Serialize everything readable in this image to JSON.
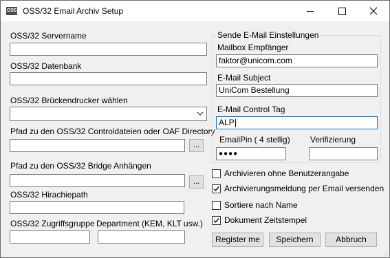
{
  "window": {
    "title": "OSS/32 Email Archiv Setup",
    "icon_text": "OSS"
  },
  "left": {
    "servername": {
      "label": "OSS/32 Servername",
      "value": ""
    },
    "datenbank": {
      "label": "OSS/32 Datenbank",
      "value": ""
    },
    "drucker": {
      "label": "OSS/32 Brückendrucker wählen",
      "value": ""
    },
    "controlpfad": {
      "label": "Pfad zu den OSS/32 Controldateien oder OAF Directory",
      "value": "",
      "browse": "..."
    },
    "bridgepfad": {
      "label": "Pfad zu den OSS/32 Bridge Anhängen",
      "value": "",
      "browse": "..."
    },
    "hirachie": {
      "label": "OSS/32 Hirachiepath",
      "value": ""
    },
    "zugriff": {
      "label": "OSS/32 Zugriffsgruppe",
      "value": ""
    },
    "department": {
      "label": "Department (KEM, KLT usw.)",
      "value": ""
    }
  },
  "email": {
    "group_title": "Sende E-Mail Einstellungen",
    "empfaenger": {
      "label": "Mailbox Empfänger",
      "value": "faktor@unicom.com"
    },
    "subject": {
      "label": "E-Mail Subject",
      "value": "UniCom Bestellung"
    },
    "control_tag": {
      "label": "E-Mail Control Tag",
      "value": "ALP"
    },
    "pin": {
      "label": "EmailPin ( 4 stellig)",
      "value": "●●●●"
    },
    "verifizierung": {
      "label": "Verifizierung",
      "value": ""
    }
  },
  "options": [
    {
      "label": "Archivieren ohne Benutzerangabe",
      "checked": false
    },
    {
      "label": "Archivierungsmeldung per Email versenden",
      "checked": true
    },
    {
      "label": "Sortiere nach Name",
      "checked": false
    },
    {
      "label": "Dokument Zeitstempel",
      "checked": true
    }
  ],
  "buttons": {
    "register": "Register me",
    "speichern": "Speichern",
    "abbruch": "Abbruch"
  }
}
